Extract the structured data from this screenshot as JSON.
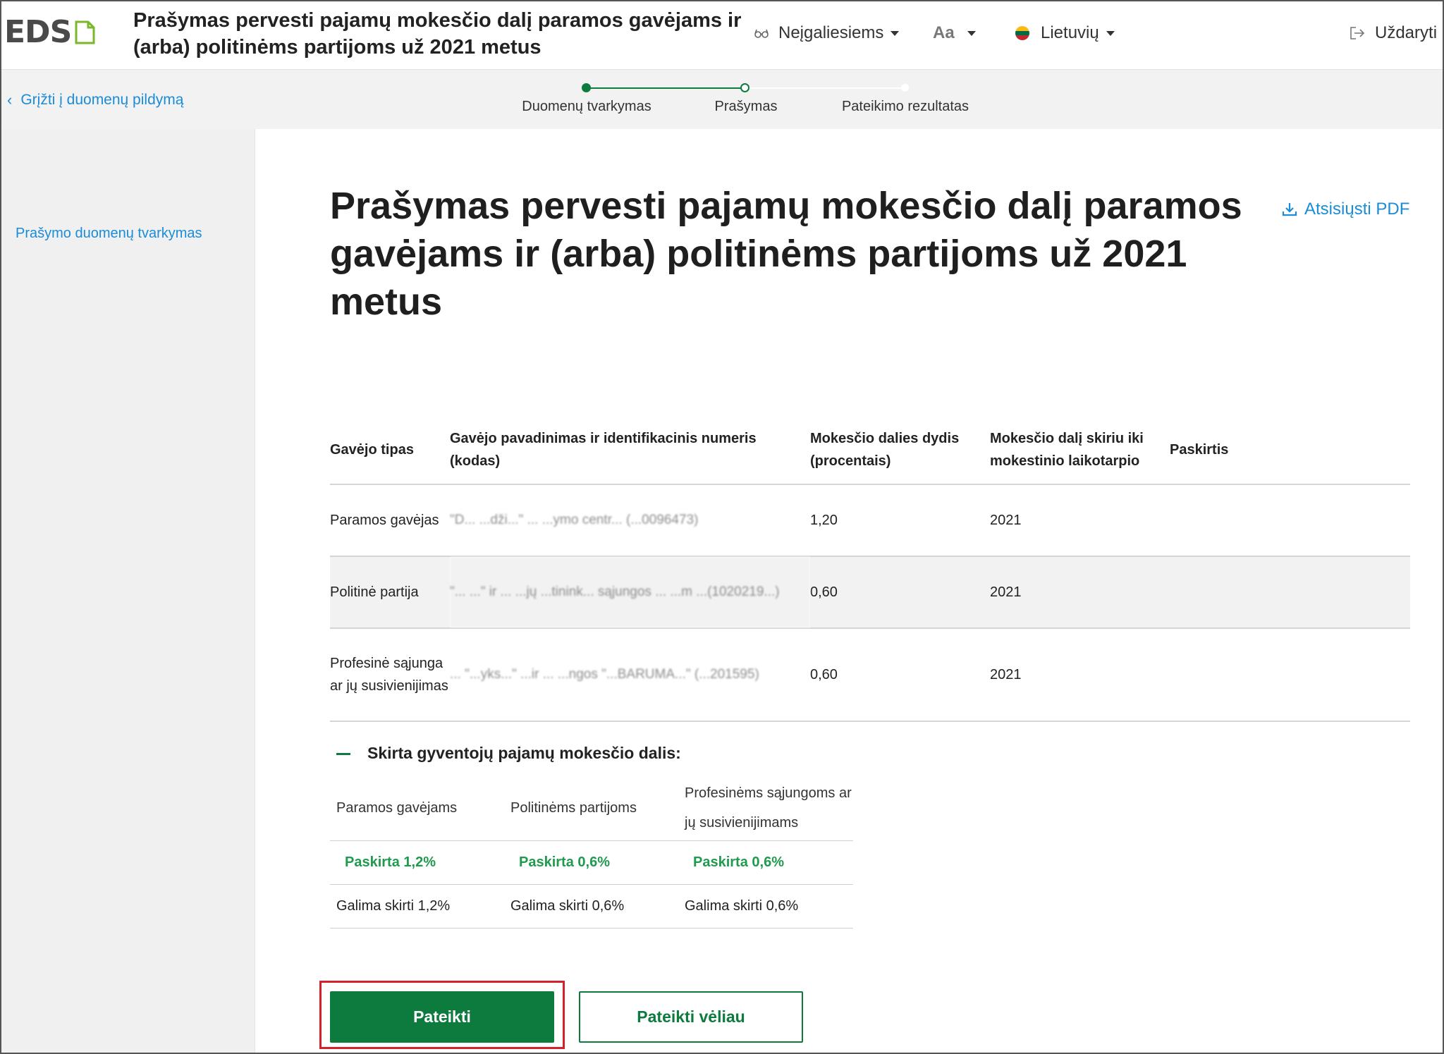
{
  "app": {
    "logo_text": "EDS",
    "title": "Prašymas pervesti pajamų mokesčio dalį paramos gavėjams ir (arba) politinėms partijoms už 2021 metus"
  },
  "header": {
    "accessibility_label": "Neįgaliesiems",
    "font_size_label": "Aa",
    "language_label": "Lietuvių",
    "close_label": "Uždaryti"
  },
  "subbar": {
    "back_label": "Grįžti į duomenų pildymą",
    "steps": [
      {
        "label": "Duomenų tvarkymas",
        "state": "completed"
      },
      {
        "label": "Prašymas",
        "state": "current"
      },
      {
        "label": "Pateikimo rezultatas",
        "state": "upcoming"
      }
    ]
  },
  "sidebar": {
    "items": [
      {
        "label": "Prašymo duomenų tvarkymas"
      }
    ]
  },
  "main": {
    "title": "Prašymas pervesti pajamų mokesčio dalį paramos gavėjams ir (arba) politinėms partijoms už 2021 metus",
    "download_pdf_label": "Atsisiųsti PDF",
    "table": {
      "headers": [
        "Gavėjo tipas",
        "Gavėjo pavadinimas ir identifikacinis numeris (kodas)",
        "Mokesčio dalies dydis (procentais)",
        "Mokesčio dalį skiriu iki mokestinio laikotarpio",
        "Paskirtis"
      ],
      "rows": [
        {
          "type": "Paramos gavėjas",
          "recipient": "\"D... ...dži...\" ... ...ymo centr... (...0096473)",
          "percent": "1,20",
          "until": "2021",
          "purpose": ""
        },
        {
          "type": "Politinė partija",
          "recipient": "\"... ...\" ir ... ...jų ...tinink... sąjungos ... ...m ...(1020219...)",
          "percent": "0,60",
          "until": "2021",
          "purpose": ""
        },
        {
          "type": "Profesinė sąjunga ar jų susivienijimas",
          "recipient": "... \"...yks...\" ...ir ... ...ngos \"...BARUMA...\" (...201595)",
          "percent": "0,60",
          "until": "2021",
          "purpose": ""
        }
      ]
    },
    "summary": {
      "title": "Skirta gyventojų pajamų mokesčio dalis:",
      "columns": [
        "Paramos gavėjams",
        "Politinėms partijoms",
        "Profesinėms sąjungoms ar jų susivienijimams"
      ],
      "assigned": [
        "Paskirta 1,2%",
        "Paskirta 0,6%",
        "Paskirta 0,6%"
      ],
      "available": [
        "Galima skirti 1,2%",
        "Galima skirti 0,6%",
        "Galima skirti 0,6%"
      ]
    },
    "buttons": {
      "submit": "Pateikti",
      "submit_later": "Pateikti vėliau"
    }
  },
  "colors": {
    "primary_green": "#0d7a3e",
    "assigned_green": "#1f9a4e",
    "link_blue": "#1a8cd8",
    "highlight_red": "#d6202a"
  }
}
